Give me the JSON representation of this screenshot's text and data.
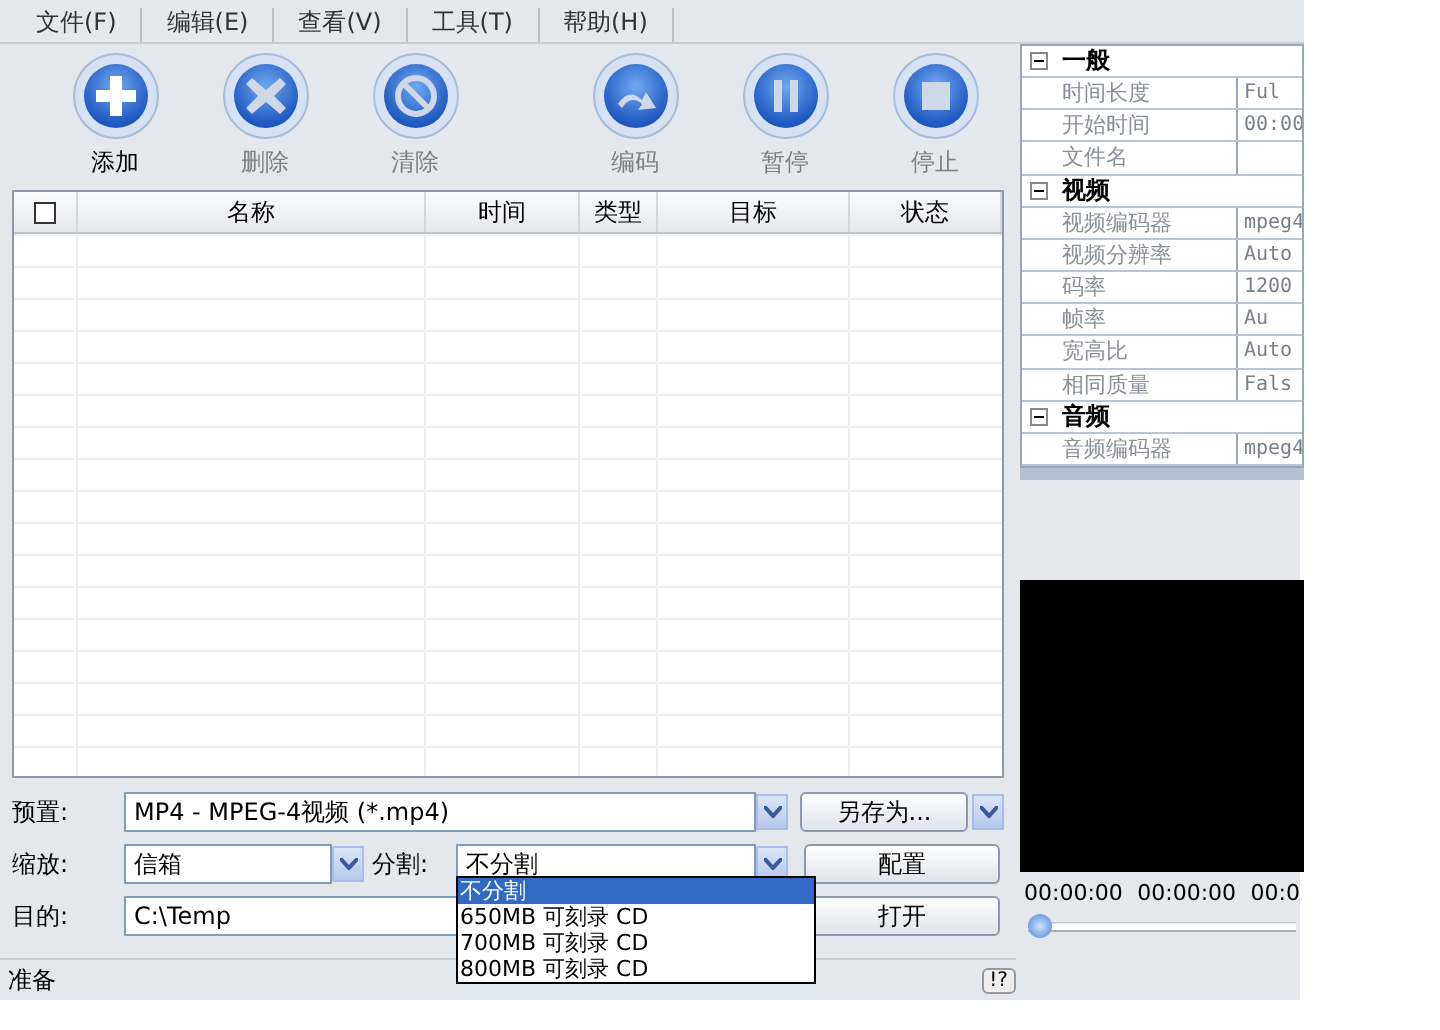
{
  "menu": [
    {
      "label": "文件(F)"
    },
    {
      "label": "编辑(E)"
    },
    {
      "label": "查看(V)"
    },
    {
      "label": "工具(T)"
    },
    {
      "label": "帮助(H)"
    }
  ],
  "toolbar": [
    {
      "label": "添加",
      "kind": "add",
      "disabled": false
    },
    {
      "label": "删除",
      "kind": "delete",
      "disabled": true
    },
    {
      "label": "清除",
      "kind": "clear",
      "disabled": true
    },
    {
      "label": "编码",
      "kind": "encode",
      "disabled": true
    },
    {
      "label": "暂停",
      "kind": "pause",
      "disabled": true
    },
    {
      "label": "停止",
      "kind": "stop",
      "disabled": true
    }
  ],
  "table": {
    "select_all": {
      "checked": false
    },
    "columns": [
      "名称",
      "时间",
      "类型",
      "目标",
      "状态"
    ]
  },
  "controls": {
    "preset_label": "预置:",
    "preset_value": "MP4 - MPEG-4视频 (*.mp4)",
    "save_as": "另存为...",
    "zoom_label": "缩放:",
    "zoom_value": "信箱",
    "split_label": "分割:",
    "split_value": "不分割",
    "configure": "配置",
    "target_label": "目的:",
    "target_value": "C:\\Temp",
    "open": "打开",
    "split_options": [
      {
        "label": "不分割",
        "selected": true
      },
      {
        "label": "650MB 可刻录 CD",
        "selected": false
      },
      {
        "label": "700MB 可刻录 CD",
        "selected": false
      },
      {
        "label": "800MB 可刻录 CD",
        "selected": false
      }
    ]
  },
  "status_bar": {
    "text": "准备",
    "help": "!?"
  },
  "properties": [
    {
      "name": "一般",
      "expanded": true,
      "children": [
        {
          "name": "时间长度",
          "value": "Ful"
        },
        {
          "name": "开始时间",
          "value": "00:00"
        },
        {
          "name": "文件名"
        }
      ]
    },
    {
      "name": "视频",
      "expanded": true,
      "children": [
        {
          "name": "视频编码器",
          "value": "mpeg4"
        },
        {
          "name": "视频分辨率",
          "value": "Auto"
        },
        {
          "name": "码率",
          "value": "1200"
        },
        {
          "name": "帧率",
          "value": "Au"
        },
        {
          "name": "宽高比",
          "value": "Auto"
        },
        {
          "name": "相同质量",
          "value": "Fals"
        }
      ]
    },
    {
      "name": "音频",
      "expanded": true,
      "children": [
        {
          "name": "音频编码器",
          "value": "mpeg4"
        }
      ]
    }
  ],
  "player": {
    "times": [
      "00:00:00",
      "00:00:00",
      "00:0"
    ],
    "level": 0
  }
}
